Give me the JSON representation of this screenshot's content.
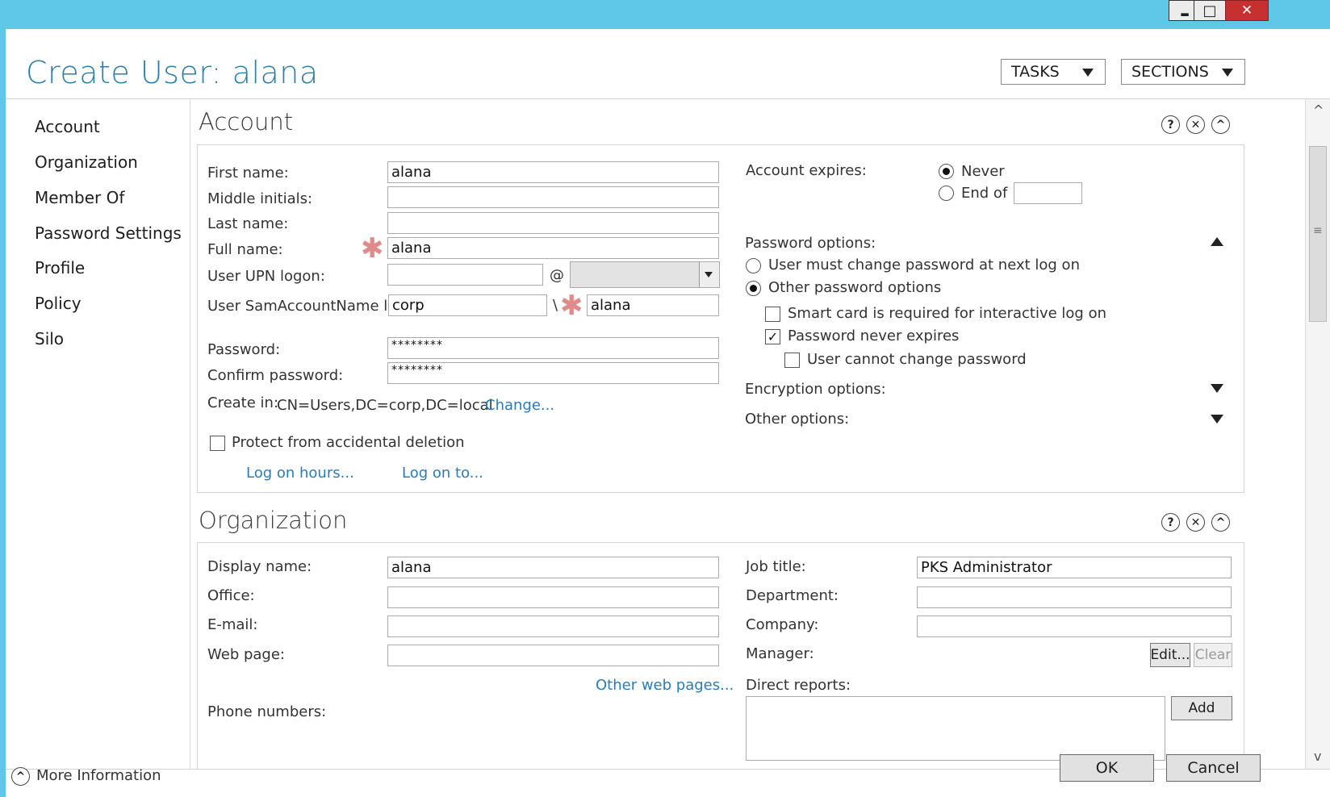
{
  "window": {
    "minimize_glyph": "▂",
    "maximize_glyph": "□",
    "close_glyph": "✕",
    "title_bar_color": "#5fc8e8"
  },
  "header": {
    "title": "Create User: alana",
    "tasks_label": "TASKS",
    "sections_label": "SECTIONS"
  },
  "sidebar": {
    "items": [
      {
        "label": "Account"
      },
      {
        "label": "Organization"
      },
      {
        "label": "Member Of"
      },
      {
        "label": "Password Settings"
      },
      {
        "label": "Profile"
      },
      {
        "label": "Policy"
      },
      {
        "label": "Silo"
      }
    ]
  },
  "account": {
    "section_title": "Account",
    "help_glyph": "?",
    "close_glyph": "✕",
    "collapse_glyph": "^",
    "first_name_label": "First name:",
    "first_name_value": "alana",
    "middle_initials_label": "Middle initials:",
    "middle_initials_value": "",
    "last_name_label": "Last name:",
    "last_name_value": "",
    "full_name_label": "Full name:",
    "full_name_value": "alana",
    "required_glyph": "✱",
    "upn_label": "User UPN logon:",
    "upn_value": "",
    "at_sign": "@",
    "upn_domain_value": "",
    "sam_label": "User SamAccountName l...",
    "sam_domain_value": "corp",
    "sam_separator": "\\",
    "sam_name_value": "alana",
    "password_label": "Password:",
    "password_value": "********",
    "confirm_label": "Confirm password:",
    "confirm_value": "********",
    "create_in_label": "Create in:",
    "create_in_value": "CN=Users,DC=corp,DC=local",
    "change_link": "Change...",
    "protect_label": "Protect from accidental deletion",
    "protect_checked": false,
    "logon_hours_link": "Log on hours...",
    "logon_to_link": "Log on to...",
    "account_expires_label": "Account expires:",
    "never_label": "Never",
    "never_selected": true,
    "end_of_label": "End of",
    "end_of_value": "",
    "password_options_label": "Password options:",
    "must_change_label": "User must change password at next log on",
    "other_pw_label": "Other password options",
    "other_pw_selected": true,
    "smart_card_label": "Smart card is required for interactive log on",
    "smart_card_checked": false,
    "never_expires_label": "Password never expires",
    "never_expires_checked": true,
    "cannot_change_label": "User cannot change password",
    "cannot_change_checked": false,
    "encryption_label": "Encryption options:",
    "other_options_label": "Other options:",
    "check_glyph": "✓"
  },
  "organization": {
    "section_title": "Organization",
    "display_name_label": "Display name:",
    "display_name_value": "alana",
    "office_label": "Office:",
    "office_value": "",
    "email_label": "E-mail:",
    "email_value": "",
    "web_page_label": "Web page:",
    "web_page_value": "",
    "other_web_link": "Other web pages...",
    "phone_label": "Phone numbers:",
    "job_title_label": "Job title:",
    "job_title_value": "PKS Administrator",
    "department_label": "Department:",
    "department_value": "",
    "company_label": "Company:",
    "company_value": "",
    "manager_label": "Manager:",
    "edit_label": "Edit...",
    "clear_label": "Clear",
    "direct_reports_label": "Direct reports:",
    "add_label": "Add"
  },
  "scrollbar": {
    "up_glyph": "^",
    "down_glyph": "v",
    "grip_glyph": "≡"
  },
  "footer": {
    "more_info_label": "More Information",
    "ok_label": "OK",
    "cancel_label": "Cancel"
  }
}
